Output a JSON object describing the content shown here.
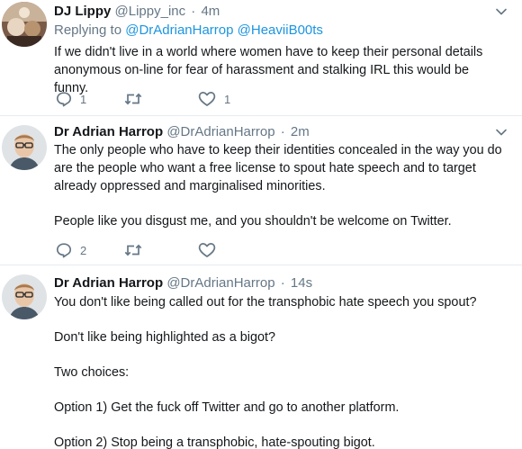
{
  "tweets": [
    {
      "name": "DJ Lippy",
      "handle": "@Lippy_inc",
      "dot": "·",
      "time": "4m",
      "replying_prefix": "Replying to",
      "mentions": [
        "@DrAdrianHarrop",
        "@HeaviiB00ts"
      ],
      "paragraphs": [
        "If we didn't live in a world where women have to keep their personal details anonymous on-line for fear of harassment and stalking IRL this would be funny."
      ],
      "reply_count": "1",
      "retweet_count": "",
      "like_count": "1"
    },
    {
      "name": "Dr Adrian Harrop",
      "handle": "@DrAdrianHarrop",
      "dot": "·",
      "time": "2m",
      "paragraphs": [
        "The only people who have to keep their identities concealed in the way you do are the people who want a free license to spout hate speech and to target already oppressed and marginalised minorities.",
        "People like you disgust me, and you shouldn't be welcome on Twitter."
      ],
      "reply_count": "2",
      "retweet_count": "",
      "like_count": ""
    },
    {
      "name": "Dr Adrian Harrop",
      "handle": "@DrAdrianHarrop",
      "dot": "·",
      "time": "14s",
      "paragraphs": [
        "You don't like being called out for the transphobic hate speech you spout?",
        "Don't like being highlighted as a bigot?",
        "Two choices:",
        "Option 1) Get the fuck off Twitter and go to another platform.",
        "Option 2) Stop being a transphobic, hate-spouting bigot."
      ]
    }
  ],
  "icons": {
    "reply": "reply-icon",
    "retweet": "retweet-icon",
    "like": "heart-icon",
    "menu": "chevron-down-icon"
  },
  "colors": {
    "text": "#14171a",
    "secondary": "#657786",
    "link": "#1b95e0",
    "divider": "#e6ecf0"
  }
}
